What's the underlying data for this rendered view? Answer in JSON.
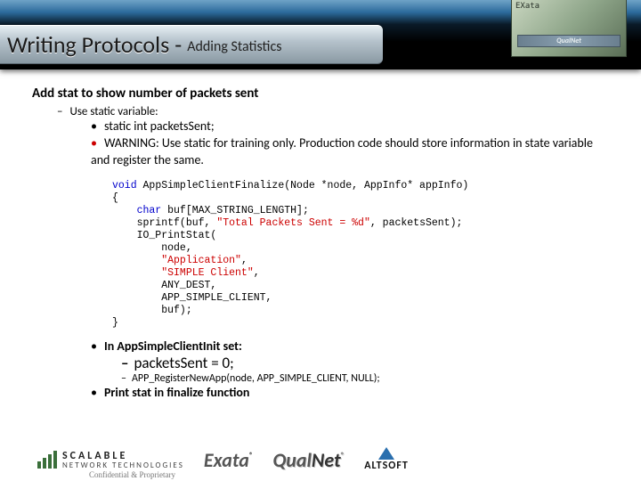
{
  "header": {
    "title_main": "Writing Protocols",
    "title_sep": "-",
    "title_sub": "Adding Statistics",
    "corner_label": "EXata",
    "corner_brand": "QualNet"
  },
  "section": {
    "heading": "Add stat to show number of packets sent",
    "use_static": "Use static variable:",
    "bullet_static": "static int packetsSent;",
    "bullet_warning": "WARNING: Use static for training only. Production code should store information in state variable and register the same."
  },
  "code": {
    "l1a": "void",
    "l1b": " AppSimpleClientFinalize(Node *node, AppInfo* appInfo)",
    "l2": "{",
    "l3a": "    char",
    "l3b": " buf[MAX_STRING_LENGTH];",
    "l4a": "    sprintf(buf, ",
    "l4b": "\"Total Packets Sent = %d\"",
    "l4c": ", packetsSent);",
    "l5": "    IO_PrintStat(",
    "l6": "        node,",
    "l7a": "        ",
    "l7b": "\"Application\"",
    "l7c": ",",
    "l8a": "        ",
    "l8b": "\"SIMPLE Client\"",
    "l8c": ",",
    "l9": "        ANY_DEST,",
    "l10": "        APP_SIMPLE_CLIENT,",
    "l11": "        buf);",
    "l12": "}"
  },
  "post": {
    "init_line": "In AppSimpleClientInit set:",
    "set_zero": "packetsSent = 0;",
    "register": "APP_RegisterNewApp(node, APP_SIMPLE_CLIENT, NULL);",
    "print_line": "Print stat in finalize function"
  },
  "footer": {
    "scalable_top": "SCALABLE",
    "scalable_bottom": "NETWORK TECHNOLOGIES",
    "exata": "Exata",
    "qualnet_a": "Qual",
    "qualnet_b": "Net",
    "altsoft": "ALTSOFT",
    "reg": "®",
    "confidential": "Confidential & Proprietary"
  }
}
